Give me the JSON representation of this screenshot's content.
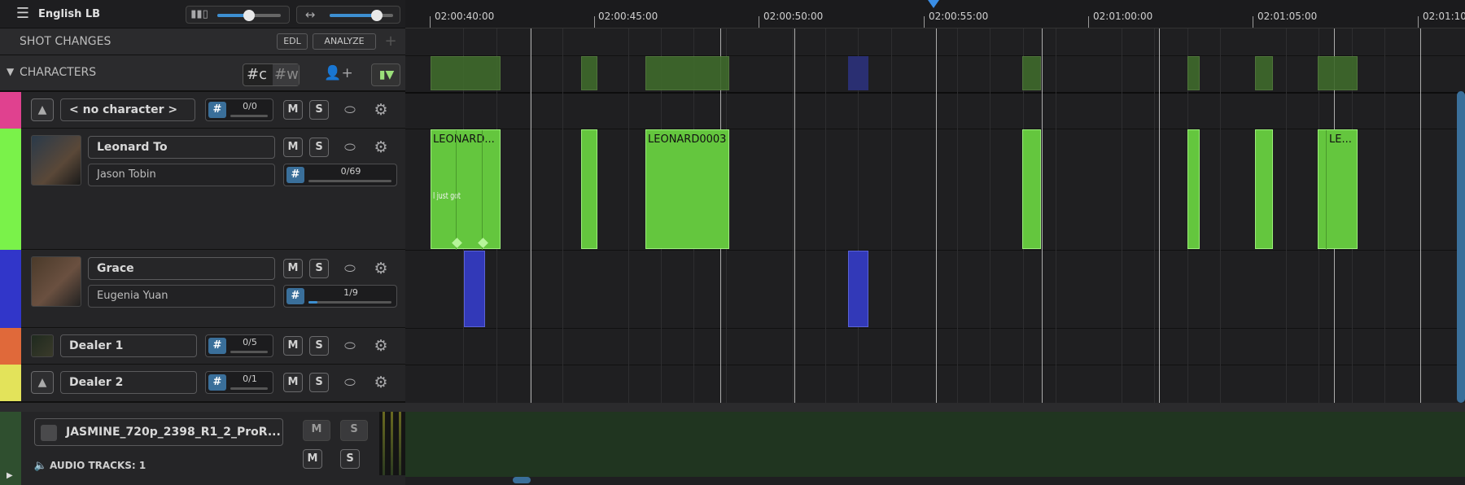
{
  "header": {
    "title": "English LB",
    "slider_volume": 0.5,
    "slider_zoom": 0.75
  },
  "shot_changes": {
    "label": "SHOT CHANGES",
    "edl_label": "EDL",
    "analyze_label": "ANALYZE"
  },
  "characters_section": {
    "label": "CHARACTERS",
    "hash_c": "#c",
    "hash_w": "#w"
  },
  "characters": [
    {
      "name": "< no character >",
      "actor": "",
      "count": "0/0",
      "progress": 0,
      "color": "#e0418f",
      "m": "M",
      "s": "S"
    },
    {
      "name": "Leonard To",
      "actor": "Jason Tobin",
      "count": "0/69",
      "progress": 0,
      "color": "#7af24a",
      "m": "M",
      "s": "S"
    },
    {
      "name": "Grace",
      "actor": "Eugenia Yuan",
      "count": "1/9",
      "progress": 0.11,
      "color": "#3136c9",
      "m": "M",
      "s": "S"
    },
    {
      "name": "Dealer 1",
      "actor": "",
      "count": "0/5",
      "progress": 0,
      "color": "#e0693a",
      "m": "M",
      "s": "S"
    },
    {
      "name": "Dealer 2",
      "actor": "",
      "count": "0/1",
      "progress": 0,
      "color": "#e3e35a",
      "m": "M",
      "s": "S"
    }
  ],
  "video_track": {
    "name": "JASMINE_720p_2398_R1_2_ProR...",
    "audio_tracks": "AUDIO TRACKS: 1",
    "m": "M",
    "s": "S"
  },
  "ruler": {
    "labels": [
      "02:00:40:00",
      "02:00:45:00",
      "02:00:50:00",
      "02:00:55:00",
      "02:01:00:00",
      "02:01:05:00",
      "02:01:10"
    ]
  },
  "clips": {
    "leonard_1": "LEONARD...",
    "leonard_1_sub": "I just got",
    "leonard_3": "LEONARD0003",
    "leonard_last": "LE..."
  },
  "colors": {
    "accent": "#3a8ee6",
    "clip_green": "#64c63e",
    "clip_blue": "#3239b8"
  }
}
